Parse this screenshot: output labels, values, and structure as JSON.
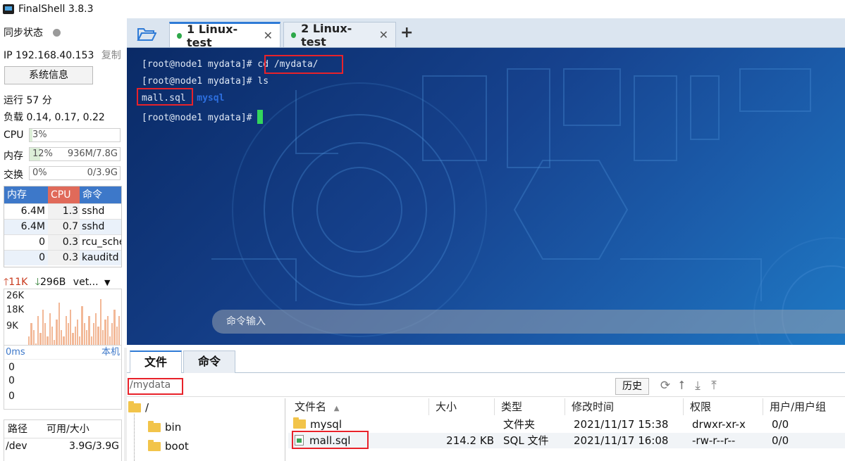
{
  "app": {
    "title": "FinalShell 3.8.3"
  },
  "left": {
    "sync_label": "同步状态",
    "ip_label": "IP 192.168.40.153",
    "copy_label": "复制",
    "sysinfo_button": "系统信息",
    "uptime": "运行 57 分",
    "load": "负载 0.14, 0.17, 0.22",
    "cpu": {
      "label": "CPU",
      "value": "3%",
      "fraction": 0.03
    },
    "mem": {
      "label": "内存",
      "value": "12%",
      "detail": "936M/7.8G",
      "fraction": 0.12
    },
    "swap": {
      "label": "交换",
      "value": "0%",
      "detail": "0/3.9G",
      "fraction": 0.0
    },
    "proc_headers": [
      "内存",
      "CPU",
      "命令"
    ],
    "processes": [
      {
        "mem": "6.4M",
        "cpu": "1.3",
        "cmd": "sshd"
      },
      {
        "mem": "6.4M",
        "cpu": "0.7",
        "cmd": "sshd"
      },
      {
        "mem": "0",
        "cpu": "0.3",
        "cmd": "rcu_sche"
      },
      {
        "mem": "0",
        "cpu": "0.3",
        "cmd": "kauditd"
      }
    ],
    "net": {
      "up": "11K",
      "down": "296B",
      "iface": "vet..."
    },
    "net_axis": [
      "26K",
      "18K",
      "9K"
    ],
    "net_values": [
      0.3,
      0.5,
      0.4,
      0.2,
      0.6,
      0.35,
      0.7,
      0.5,
      0.3,
      0.65,
      0.45,
      0.25,
      0.55,
      0.8,
      0.4,
      0.3,
      0.6,
      0.5,
      0.7,
      0.35,
      0.45,
      0.55,
      0.3,
      0.75,
      0.5,
      0.4,
      0.6,
      0.3,
      0.5,
      0.65,
      0.45,
      0.85,
      0.4,
      0.55,
      0.6,
      0.3,
      0.5,
      0.7,
      0.45,
      0.6
    ],
    "ping": {
      "ms": "0ms",
      "host": "本机",
      "values": [
        "0",
        "0",
        "0"
      ]
    },
    "disk": {
      "headers": [
        "路径",
        "可用/大小"
      ],
      "rows": [
        {
          "path": "/dev",
          "size": "3.9G/3.9G"
        }
      ]
    }
  },
  "tabs": [
    {
      "label": "1 Linux-test",
      "active": true
    },
    {
      "label": "2 Linux-test",
      "active": false
    }
  ],
  "terminal": {
    "lines": [
      {
        "prompt": "[root@node1 mydata]# ",
        "cmd": "cd /mydata/"
      },
      {
        "prompt": "[root@node1 mydata]# ",
        "cmd": "ls"
      },
      {
        "file": "mall.sql",
        "dir": "mysql"
      },
      {
        "prompt": "[root@node1 mydata]# "
      }
    ],
    "command_input_placeholder": "命令输入"
  },
  "bottom": {
    "tabs": [
      "文件",
      "命令"
    ],
    "path": "/mydata",
    "history_button": "历史",
    "tree": [
      {
        "name": "/"
      },
      {
        "name": "bin"
      },
      {
        "name": "boot"
      }
    ],
    "columns": [
      "文件名",
      "大小",
      "类型",
      "修改时间",
      "权限",
      "用户/用户组"
    ],
    "files": [
      {
        "name": "mysql",
        "size": "",
        "type": "文件夹",
        "mtime": "2021/11/17 15:38",
        "perm": "drwxr-xr-x",
        "owner": "0/0"
      },
      {
        "name": "mall.sql",
        "size": "214.2 KB",
        "type": "SQL 文件",
        "mtime": "2021/11/17 16:08",
        "perm": "-rw-r--r--",
        "owner": "0/0"
      }
    ]
  }
}
